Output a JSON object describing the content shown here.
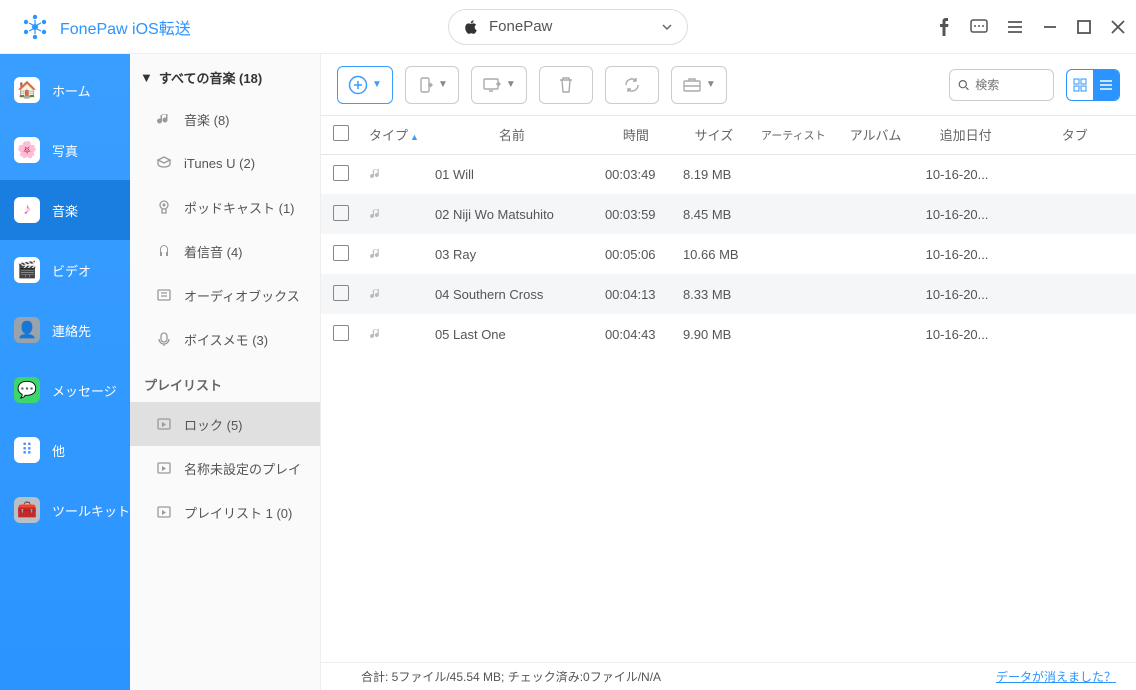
{
  "app": {
    "title": "FonePaw iOS転送"
  },
  "device": {
    "name": "FonePaw"
  },
  "sidebar": {
    "items": [
      {
        "label": "ホーム",
        "icon_bg": "#ff8a3c"
      },
      {
        "label": "写真",
        "icon_bg": "#3ec6ff"
      },
      {
        "label": "音楽",
        "icon_bg": "#ff6bb3"
      },
      {
        "label": "ビデオ",
        "icon_bg": "#34d0b6"
      },
      {
        "label": "連絡先",
        "icon_bg": "#9aa3ab"
      },
      {
        "label": "メッセージ",
        "icon_bg": "#3cd66a"
      },
      {
        "label": "他",
        "icon_bg": "#4a8cff"
      },
      {
        "label": "ツールキット",
        "icon_bg": "#b8c0c7"
      }
    ]
  },
  "tree": {
    "header": "すべての音楽 (18)",
    "categories": [
      {
        "label": "音楽 (8)"
      },
      {
        "label": "iTunes U (2)"
      },
      {
        "label": "ポッドキャスト (1)"
      },
      {
        "label": "着信音 (4)"
      },
      {
        "label": "オーディオブックス"
      },
      {
        "label": "ボイスメモ (3)"
      }
    ],
    "playlist_section": "プレイリスト",
    "playlists": [
      {
        "label": "ロック (5)",
        "selected": true
      },
      {
        "label": "名称未設定のプレイ"
      },
      {
        "label": "プレイリスト 1 (0)"
      }
    ]
  },
  "search": {
    "placeholder": "検索"
  },
  "table": {
    "cols": {
      "type": "タイプ",
      "name": "名前",
      "time": "時間",
      "size": "サイズ",
      "artist": "アーティスト",
      "album": "アルバム",
      "added": "追加日付",
      "tab": "タブ"
    },
    "rows": [
      {
        "name": "01 Will",
        "time": "00:03:49",
        "size": "8.19 MB",
        "artist": "",
        "album": "",
        "added": "10-16-20..."
      },
      {
        "name": "02 Niji Wo Matsuhito",
        "time": "00:03:59",
        "size": "8.45 MB",
        "artist": "",
        "album": "",
        "added": "10-16-20..."
      },
      {
        "name": "03 Ray",
        "time": "00:05:06",
        "size": "10.66 MB",
        "artist": "",
        "album": "",
        "added": "10-16-20..."
      },
      {
        "name": "04 Southern Cross",
        "time": "00:04:13",
        "size": "8.33 MB",
        "artist": "",
        "album": "",
        "added": "10-16-20..."
      },
      {
        "name": "05 Last One",
        "time": "00:04:43",
        "size": "9.90 MB",
        "artist": "",
        "album": "",
        "added": "10-16-20..."
      }
    ]
  },
  "status": {
    "text": "合計: 5ファイル/45.54 MB; チェック済み:0ファイル/N/A",
    "lost_link": "データが消えました？"
  }
}
